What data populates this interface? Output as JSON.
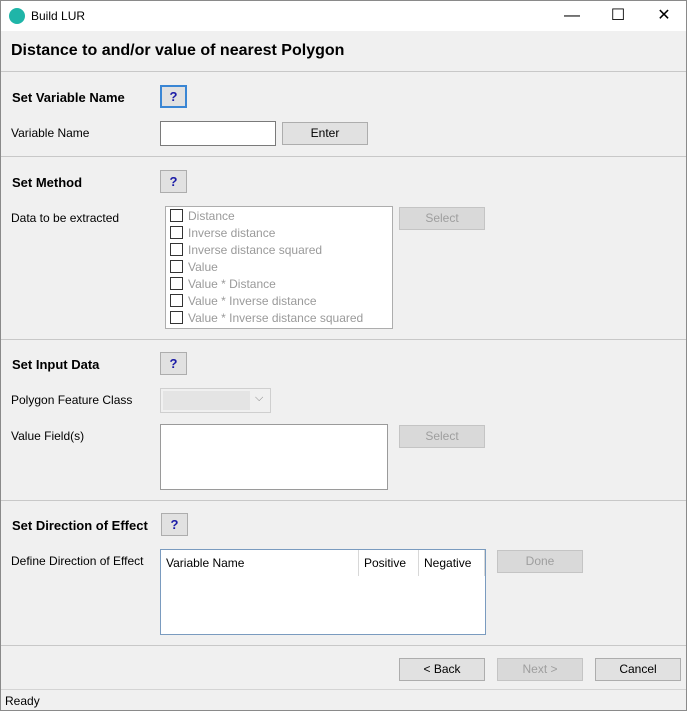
{
  "window": {
    "title": "Build LUR",
    "minimize": "—",
    "maximize": "☐",
    "close": "✕"
  },
  "header": {
    "title": "Distance to and/or value of nearest Polygon"
  },
  "sections": {
    "variable_name": {
      "title": "Set Variable Name",
      "help": "?",
      "field_label": "Variable Name",
      "field_value": "",
      "enter_label": "Enter"
    },
    "method": {
      "title": "Set Method",
      "help": "?",
      "field_label": "Data to be extracted",
      "options": [
        "Distance",
        "Inverse distance",
        "Inverse distance squared",
        "Value",
        "Value * Distance",
        "Value * Inverse distance",
        "Value * Inverse distance squared"
      ],
      "select_label": "Select"
    },
    "input_data": {
      "title": "Set Input Data",
      "help": "?",
      "polygon_label": "Polygon Feature Class",
      "polygon_value": "",
      "value_fields_label": "Value Field(s)",
      "select_label": "Select"
    },
    "direction": {
      "title": "Set Direction of Effect",
      "help": "?",
      "field_label": "Define Direction of Effect",
      "columns": [
        "Variable Name",
        "Positive",
        "Negative"
      ],
      "done_label": "Done"
    }
  },
  "footer": {
    "back": "< Back",
    "next": "Next >",
    "cancel": "Cancel"
  },
  "status": {
    "text": "Ready"
  }
}
